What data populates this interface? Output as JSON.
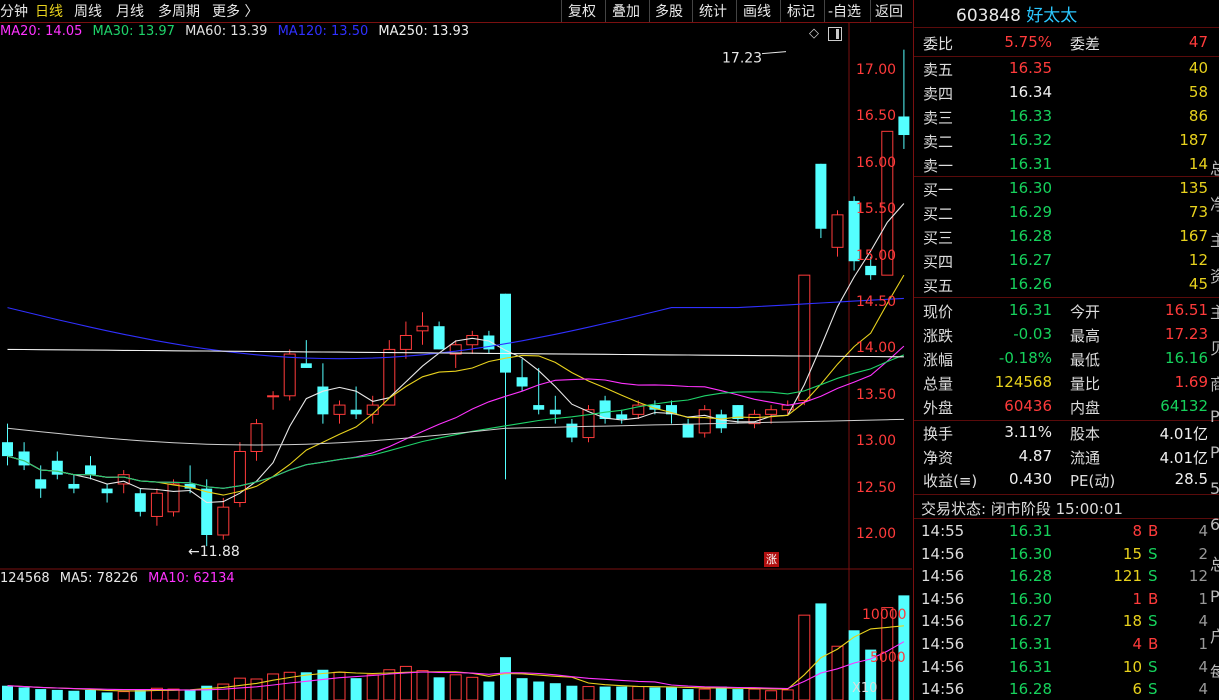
{
  "toolbar": {
    "left_items": [
      "分钟",
      "日线",
      "周线",
      "月线",
      "多周期",
      "更多 〉"
    ],
    "right_items": [
      "复权",
      "叠加",
      "多股",
      "统计",
      "画线",
      "标记",
      "-自选",
      "返回"
    ],
    "active_item": "日线"
  },
  "stock": {
    "code": "603848",
    "name": "好太太"
  },
  "ma_legend": [
    {
      "text": "MA20: 14.05",
      "color": "#ff33ff"
    },
    {
      "text": "MA30: 13.97",
      "color": "#1fd36a"
    },
    {
      "text": "MA60: 13.39",
      "color": "#e0e0e0"
    },
    {
      "text": "MA120: 13.50",
      "color": "#3030ff"
    },
    {
      "text": "MA250: 13.93",
      "color": "#f0f0f0"
    }
  ],
  "vol_legend": [
    {
      "text": "124568",
      "color": "#e8e8e8"
    },
    {
      "text": "MA5: 78226",
      "color": "#e8e8e8"
    },
    {
      "text": "MA10: 62134",
      "color": "#ff33ff"
    }
  ],
  "chart_annotations": {
    "high_label": "17.23",
    "low_label": "11.88",
    "limit_tag": "涨",
    "vol_unit": "X10"
  },
  "price_axis": [
    "17.00",
    "16.50",
    "16.00",
    "15.50",
    "15.00",
    "14.50",
    "14.00",
    "13.50",
    "13.00",
    "12.50",
    "12.00"
  ],
  "volume_axis": [
    "10000",
    "5000"
  ],
  "order_book": {
    "weibi_label": "委比",
    "weibi_value": "5.75%",
    "weicha_label": "委差",
    "weicha_value": "47",
    "sells": [
      {
        "label": "卖五",
        "price": "16.35",
        "vol": "40",
        "color": "#ff3b3b"
      },
      {
        "label": "卖四",
        "price": "16.34",
        "vol": "58",
        "color": "#f0f0f0"
      },
      {
        "label": "卖三",
        "price": "16.33",
        "vol": "86",
        "color": "#16d25c"
      },
      {
        "label": "卖二",
        "price": "16.32",
        "vol": "187",
        "color": "#16d25c"
      },
      {
        "label": "卖一",
        "price": "16.31",
        "vol": "14",
        "color": "#16d25c"
      }
    ],
    "buys": [
      {
        "label": "买一",
        "price": "16.30",
        "vol": "135",
        "color": "#16d25c"
      },
      {
        "label": "买二",
        "price": "16.29",
        "vol": "73",
        "color": "#16d25c"
      },
      {
        "label": "买三",
        "price": "16.28",
        "vol": "167",
        "color": "#16d25c"
      },
      {
        "label": "买四",
        "price": "16.27",
        "vol": "12",
        "color": "#16d25c"
      },
      {
        "label": "买五",
        "price": "16.26",
        "vol": "45",
        "color": "#16d25c"
      }
    ]
  },
  "quote": [
    {
      "l1": "现价",
      "v1": "16.31",
      "c1": "#16d25c",
      "l2": "今开",
      "v2": "16.51",
      "c2": "#ff3b3b"
    },
    {
      "l1": "涨跌",
      "v1": "-0.03",
      "c1": "#16d25c",
      "l2": "最高",
      "v2": "17.23",
      "c2": "#ff3b3b"
    },
    {
      "l1": "涨幅",
      "v1": "-0.18%",
      "c1": "#16d25c",
      "l2": "最低",
      "v2": "16.16",
      "c2": "#16d25c"
    },
    {
      "l1": "总量",
      "v1": "124568",
      "c1": "#e8d21d",
      "l2": "量比",
      "v2": "1.69",
      "c2": "#ff3b3b"
    },
    {
      "l1": "外盘",
      "v1": "60436",
      "c1": "#ff3b3b",
      "l2": "内盘",
      "v2": "64132",
      "c2": "#16d25c"
    }
  ],
  "fundamentals": [
    {
      "l1": "换手",
      "v1": "3.11%",
      "l2": "股本",
      "v2": "4.01亿"
    },
    {
      "l1": "净资",
      "v1": "4.87",
      "l2": "流通",
      "v2": "4.01亿"
    },
    {
      "l1": "收益(≡)",
      "v1": "0.430",
      "l2": "PE(动)",
      "v2": "28.5"
    }
  ],
  "trade_status": "交易状态: 闭市阶段 15:00:01",
  "ticks": [
    {
      "time": "14:55",
      "price": "16.31",
      "vol": "8",
      "bs": "B",
      "n": "4"
    },
    {
      "time": "14:56",
      "price": "16.30",
      "vol": "15",
      "bs": "S",
      "n": "2"
    },
    {
      "time": "14:56",
      "price": "16.28",
      "vol": "121",
      "bs": "S",
      "n": "12"
    },
    {
      "time": "14:56",
      "price": "16.30",
      "vol": "1",
      "bs": "B",
      "n": "1"
    },
    {
      "time": "14:56",
      "price": "16.27",
      "vol": "18",
      "bs": "S",
      "n": "4"
    },
    {
      "time": "14:56",
      "price": "16.31",
      "vol": "4",
      "bs": "B",
      "n": "1"
    },
    {
      "time": "14:56",
      "price": "16.31",
      "vol": "10",
      "bs": "S",
      "n": "4"
    },
    {
      "time": "14:56",
      "price": "16.28",
      "vol": "6",
      "bs": "S",
      "n": "4"
    }
  ],
  "edge_chars": [
    "总",
    "净",
    "主",
    "资",
    "主",
    "贝",
    "商",
    "P",
    "P",
    "5",
    "6",
    "总",
    "P",
    "户",
    "每"
  ],
  "chart_data": {
    "type": "candlestick",
    "price_range": [
      11.5,
      17.5
    ],
    "volume_range": [
      0,
      12500
    ],
    "candles": [
      [
        13.0,
        13.2,
        12.75,
        12.85
      ],
      [
        12.9,
        13.0,
        12.7,
        12.75
      ],
      [
        12.6,
        12.75,
        12.4,
        12.5
      ],
      [
        12.8,
        12.9,
        12.6,
        12.65
      ],
      [
        12.55,
        12.65,
        12.45,
        12.5
      ],
      [
        12.75,
        12.85,
        12.6,
        12.65
      ],
      [
        12.5,
        12.55,
        12.35,
        12.45
      ],
      [
        12.55,
        12.7,
        12.45,
        12.65
      ],
      [
        12.45,
        12.5,
        12.2,
        12.25
      ],
      [
        12.2,
        12.5,
        12.1,
        12.45
      ],
      [
        12.25,
        12.6,
        12.2,
        12.55
      ],
      [
        12.55,
        12.75,
        12.45,
        12.5
      ],
      [
        12.5,
        12.6,
        11.88,
        12.0
      ],
      [
        12.0,
        12.4,
        11.95,
        12.3
      ],
      [
        12.35,
        13.0,
        12.3,
        12.9
      ],
      [
        12.9,
        13.25,
        12.8,
        13.2
      ],
      [
        13.5,
        13.55,
        13.35,
        13.5
      ],
      [
        13.5,
        14.0,
        13.45,
        13.95
      ],
      [
        13.85,
        14.1,
        13.8,
        13.8
      ],
      [
        13.6,
        13.85,
        13.2,
        13.3
      ],
      [
        13.3,
        13.45,
        13.2,
        13.4
      ],
      [
        13.35,
        13.6,
        13.25,
        13.3
      ],
      [
        13.3,
        13.5,
        13.2,
        13.4
      ],
      [
        13.4,
        14.1,
        13.4,
        14.0
      ],
      [
        14.0,
        14.3,
        13.9,
        14.15
      ],
      [
        14.2,
        14.4,
        14.05,
        14.25
      ],
      [
        14.25,
        14.3,
        14.0,
        14.0
      ],
      [
        13.95,
        14.1,
        13.8,
        14.05
      ],
      [
        14.05,
        14.2,
        13.95,
        14.15
      ],
      [
        14.15,
        14.2,
        13.95,
        14.0
      ],
      [
        14.6,
        14.6,
        12.6,
        13.75
      ],
      [
        13.7,
        13.9,
        13.55,
        13.6
      ],
      [
        13.4,
        13.8,
        13.3,
        13.35
      ],
      [
        13.35,
        13.5,
        13.2,
        13.3
      ],
      [
        13.2,
        13.25,
        13.0,
        13.05
      ],
      [
        13.05,
        13.4,
        13.0,
        13.35
      ],
      [
        13.45,
        13.5,
        13.2,
        13.25
      ],
      [
        13.3,
        13.35,
        13.2,
        13.25
      ],
      [
        13.3,
        13.45,
        13.25,
        13.4
      ],
      [
        13.4,
        13.45,
        13.3,
        13.35
      ],
      [
        13.4,
        13.45,
        13.2,
        13.3
      ],
      [
        13.2,
        13.25,
        13.05,
        13.05
      ],
      [
        13.1,
        13.4,
        13.05,
        13.35
      ],
      [
        13.3,
        13.35,
        13.1,
        13.15
      ],
      [
        13.4,
        13.4,
        13.2,
        13.25
      ],
      [
        13.2,
        13.35,
        13.15,
        13.3
      ],
      [
        13.3,
        13.4,
        13.2,
        13.35
      ],
      [
        13.35,
        13.45,
        13.3,
        13.4
      ],
      [
        13.45,
        14.8,
        13.4,
        14.8
      ],
      [
        16.0,
        16.0,
        15.2,
        15.3
      ],
      [
        15.1,
        15.5,
        15.0,
        15.45
      ],
      [
        15.6,
        15.65,
        14.85,
        14.95
      ],
      [
        14.9,
        15.0,
        14.75,
        14.8
      ],
      [
        14.8,
        16.35,
        14.8,
        16.35
      ],
      [
        16.51,
        17.23,
        16.16,
        16.31
      ]
    ],
    "volumes": [
      1700,
      1500,
      1300,
      1200,
      1100,
      1200,
      900,
      1000,
      1200,
      1400,
      1300,
      1200,
      1700,
      1900,
      2600,
      2500,
      3100,
      3300,
      3300,
      3600,
      3300,
      2600,
      3000,
      3600,
      4000,
      3500,
      2700,
      3000,
      2700,
      2200,
      5100,
      2600,
      2200,
      2000,
      1700,
      1600,
      1600,
      1600,
      1600,
      1500,
      1500,
      1300,
      1300,
      1600,
      1300,
      1300,
      1100,
      1200,
      10100,
      11500,
      6400,
      8300,
      6000,
      11000,
      12456
    ]
  }
}
